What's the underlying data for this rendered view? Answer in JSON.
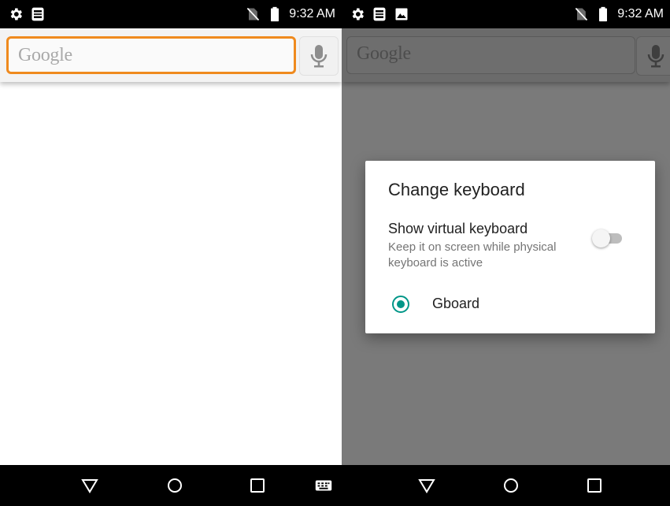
{
  "left_screen": {
    "status_bar": {
      "time": "9:32 AM",
      "icons_left": [
        "settings-icon",
        "screenshot-icon"
      ],
      "icons_right": [
        "no-sim-icon",
        "battery-icon"
      ]
    },
    "search": {
      "placeholder": "Google",
      "mic_icon": "mic-icon"
    },
    "nav_bar": {
      "buttons": [
        "back-icon",
        "home-icon",
        "recents-icon",
        "keyboard-icon"
      ]
    }
  },
  "right_screen": {
    "status_bar": {
      "time": "9:32 AM",
      "icons_left": [
        "settings-icon",
        "screenshot-icon",
        "image-icon"
      ],
      "icons_right": [
        "no-sim-icon",
        "battery-icon"
      ]
    },
    "search": {
      "placeholder": "Google",
      "mic_icon": "mic-icon"
    },
    "dialog": {
      "title": "Change keyboard",
      "option_title": "Show virtual keyboard",
      "option_desc": "Keep it on screen while physical keyboard is active",
      "toggle_on": false,
      "keyboards": [
        {
          "label": "Gboard",
          "selected": true
        }
      ]
    },
    "nav_bar": {
      "buttons": [
        "back-icon",
        "home-icon",
        "recents-icon"
      ]
    }
  },
  "colors": {
    "accent": "#009688",
    "search_focus": "#ef8a1e",
    "scrim": "#7a7a7a"
  }
}
